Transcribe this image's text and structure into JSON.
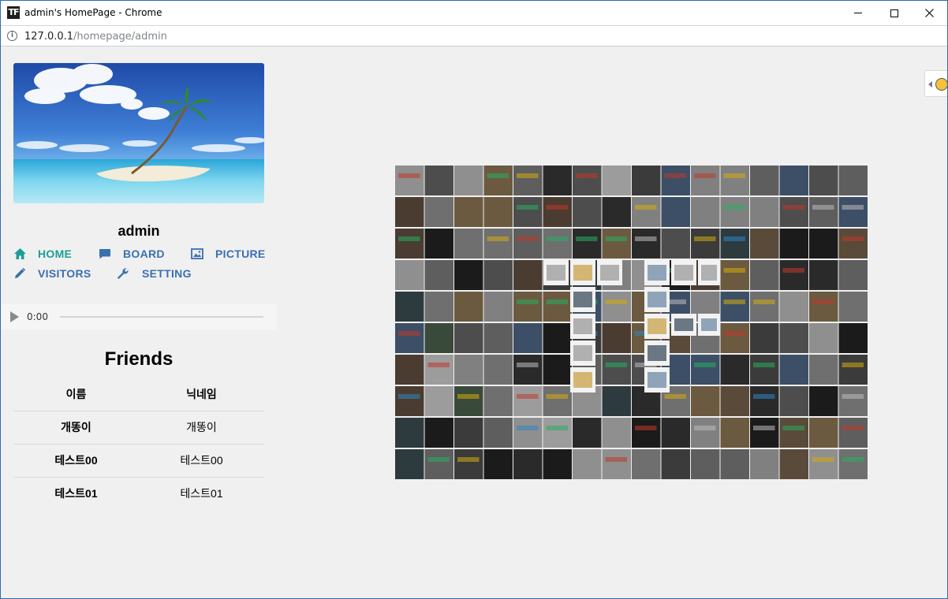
{
  "window": {
    "title": "admin's HomePage - Chrome",
    "app_icon_text": "TF"
  },
  "address": {
    "host": "127.0.0.1",
    "path": "/homepage/admin"
  },
  "profile": {
    "username": "admin"
  },
  "nav": {
    "home": "HOME",
    "board": "BOARD",
    "picture": "PICTURE",
    "visitors": "VISITORS",
    "setting": "SETTING"
  },
  "audio": {
    "time": "0:00"
  },
  "friends": {
    "title": "Friends",
    "headers": [
      "이름",
      "닉네임"
    ],
    "rows": [
      {
        "name": "개똥이",
        "nickname": "개똥이"
      },
      {
        "name": "테스트00",
        "nickname": "테스트00"
      },
      {
        "name": "테스트01",
        "nickname": "테스트01"
      }
    ]
  },
  "icons": {
    "home": "home-icon",
    "board": "comment-icon",
    "picture": "image-icon",
    "visitors": "pencil-icon",
    "setting": "wrench-icon",
    "info": "info-icon",
    "play": "play-icon"
  },
  "colors": {
    "home_accent": "#1a9e97",
    "nav_link": "#3a6fb0",
    "page_bg": "#f0f0f0",
    "window_border": "#2b6cb0"
  }
}
